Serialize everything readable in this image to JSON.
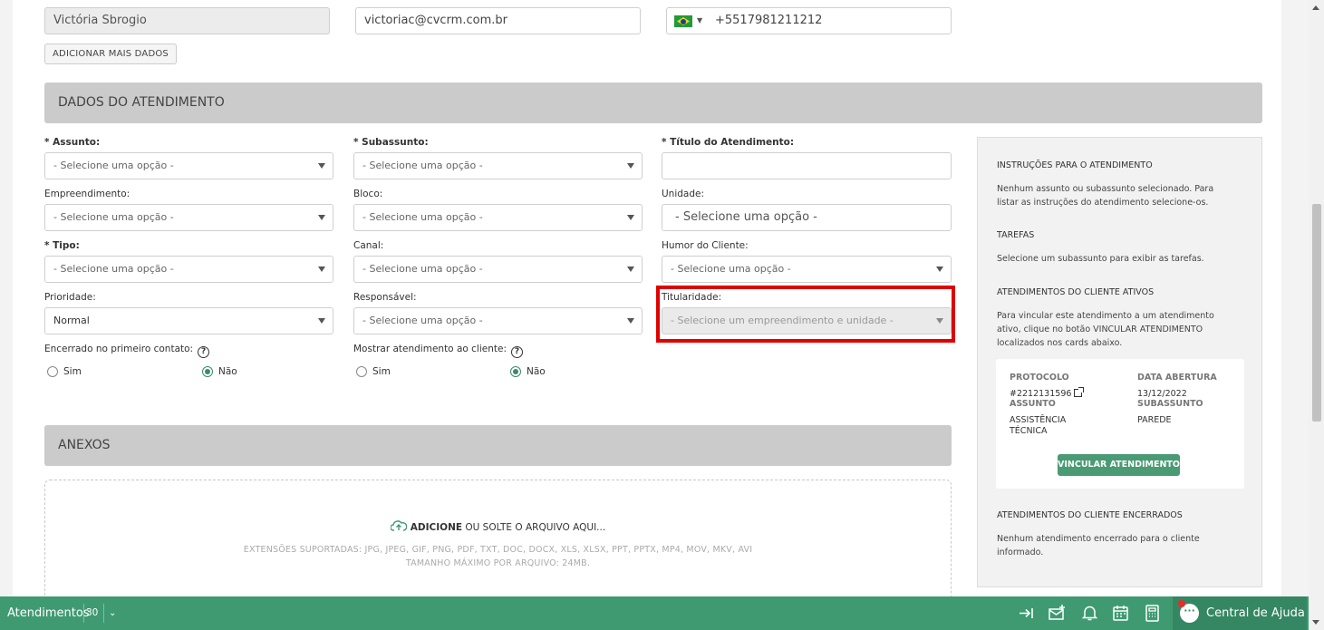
{
  "contact": {
    "name": "Victória Sbrogio",
    "email": "victoriac@cvcrm.com.br",
    "phone": "+5517981211212",
    "add_more_label": "ADICIONAR MAIS DADOS"
  },
  "atendimento": {
    "section_title": "DADOS DO ATENDIMENTO",
    "fields": {
      "assunto": {
        "label": "* Assunto:",
        "value": "- Selecione uma opção -"
      },
      "subassunto": {
        "label": "* Subassunto:",
        "value": "- Selecione uma opção -"
      },
      "titulo": {
        "label": "* Título do Atendimento:",
        "value": ""
      },
      "empreendimento": {
        "label": "Empreendimento:",
        "value": "- Selecione uma opção -"
      },
      "bloco": {
        "label": "Bloco:",
        "value": "- Selecione uma opção -"
      },
      "unidade": {
        "label": "Unidade:",
        "value": "- Selecione uma opção -"
      },
      "tipo": {
        "label": "* Tipo:",
        "value": "- Selecione uma opção -"
      },
      "canal": {
        "label": "Canal:",
        "value": "- Selecione uma opção -"
      },
      "humor": {
        "label": "Humor do Cliente:",
        "value": "- Selecione uma opção -"
      },
      "prioridade": {
        "label": "Prioridade:",
        "value": "Normal"
      },
      "responsavel": {
        "label": "Responsável:",
        "value": "- Selecione uma opção -"
      },
      "titularidade": {
        "label": "Titularidade:",
        "value": "- Selecione um empreendimento e unidade -"
      }
    },
    "encerrado": {
      "label": "Encerrado no primeiro contato:",
      "yes": "Sim",
      "no": "Não",
      "selected": "Não"
    },
    "mostrar": {
      "label": "Mostrar atendimento ao cliente:",
      "yes": "Sim",
      "no": "Não",
      "selected": "Não"
    },
    "help_glyph": "?"
  },
  "anexos": {
    "section_title": "ANEXOS",
    "add_label": "ADICIONE",
    "drop_label": "OU SOLTE O ARQUIVO AQUI...",
    "extensions": "EXTENSÕES SUPORTADAS: JPG, JPEG, GIF, PNG, PDF, TXT, DOC, DOCX, XLS, XLSX, PPT, PPTX, MP4, MOV, MKV, AVI",
    "max_size": "TAMANHO MÁXIMO POR ARQUIVO: 24MB."
  },
  "panel": {
    "instr_title": "INSTRUÇÕES PARA O ATENDIMENTO",
    "instr_text": "Nenhum assunto ou subassunto selecionado. Para listar as instruções do atendimento selecione-os.",
    "tarefas_title": "TAREFAS",
    "tarefas_text": "Selecione um subassunto para exibir as tarefas.",
    "ativos_title": "ATENDIMENTOS DO CLIENTE ATIVOS",
    "ativos_text": "Para vincular este atendimento a um atendimento ativo, clique no botão VINCULAR ATENDIMENTO localizados nos cards abaixo.",
    "card": {
      "protocolo_label": "PROTOCOLO",
      "protocolo_value": "#2212131596",
      "data_label": "DATA ABERTURA",
      "data_value": "13/12/2022",
      "assunto_label": "ASSUNTO",
      "assunto_value": "ASSISTÊNCIA TÉCNICA",
      "subassunto_label": "SUBASSUNTO",
      "subassunto_value": "PAREDE",
      "button_label": "VINCULAR ATENDIMENTO"
    },
    "encerrados_title": "ATENDIMENTOS DO CLIENTE ENCERRADOS",
    "encerrados_text": "Nenhum atendimento encerrado para o cliente informado."
  },
  "bottom_bar": {
    "atendimentos_label": "Atendimentos",
    "atendimentos_count": "30",
    "help_center_label": "Central de Ajuda"
  },
  "colors": {
    "accent_green": "#3f9a72",
    "highlight_red": "#e00000",
    "section_gray": "#cbcbcb"
  }
}
